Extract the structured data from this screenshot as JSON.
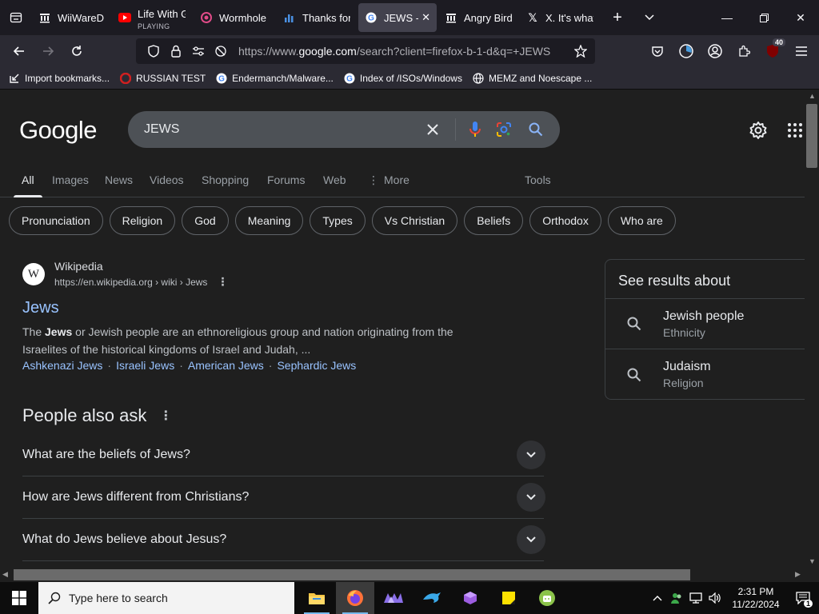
{
  "browser": {
    "tabs": [
      {
        "title": "WiiWareDL",
        "icon": "archive-icon"
      },
      {
        "title": "Life With G",
        "subtitle": "PLAYING",
        "icon": "youtube-icon"
      },
      {
        "title": "Wormhole",
        "icon": "wormhole-icon"
      },
      {
        "title": "Thanks for",
        "icon": "chart-icon"
      },
      {
        "title": "JEWS - G",
        "icon": "google-icon",
        "active": true
      },
      {
        "title": "Angry Bird",
        "icon": "archive-icon"
      },
      {
        "title": "X. It's what",
        "icon": "x-icon"
      }
    ],
    "url_prefix": "https://www.",
    "url_domain": "google.com",
    "url_rest": "/search?client=firefox-b-1-d&q=+JEWS",
    "extensions_badge": "40",
    "bookmarks": [
      {
        "label": "Import bookmarks...",
        "icon": "import-icon"
      },
      {
        "label": "RUSSIAN TEST",
        "icon": "red-circle-icon"
      },
      {
        "label": "Endermanch/Malware...",
        "icon": "google-icon"
      },
      {
        "label": "Index of /ISOs/Windows",
        "icon": "google-icon"
      },
      {
        "label": "MEMZ and Noescape ...",
        "icon": "globe-icon"
      }
    ]
  },
  "google": {
    "logo": "Google",
    "query": "JEWS",
    "tabs": [
      "All",
      "Images",
      "News",
      "Videos",
      "Shopping",
      "Forums",
      "Web",
      "More",
      "Tools"
    ],
    "chips": [
      "Pronunciation",
      "Religion",
      "God",
      "Meaning",
      "Types",
      "Vs Christian",
      "Beliefs",
      "Orthodox",
      "Who are"
    ],
    "result": {
      "source": "Wikipedia",
      "url": "https://en.wikipedia.org › wiki › Jews",
      "title": "Jews",
      "snippet_pre": "The ",
      "snippet_bold": "Jews",
      "snippet_post": " or Jewish people are an ethnoreligious group and nation originating from the Israelites of the historical kingdoms of Israel and Judah, ...",
      "sitelinks": [
        "Ashkenazi Jews",
        "Israeli Jews",
        "American Jews",
        "Sephardic Jews"
      ]
    },
    "paa": {
      "title": "People also ask",
      "questions": [
        "What are the beliefs of Jews?",
        "How are Jews different from Christians?",
        "What do Jews believe about Jesus?"
      ]
    },
    "see_results": {
      "title": "See results about",
      "items": [
        {
          "name": "Jewish people",
          "sub": "Ethnicity"
        },
        {
          "name": "Judaism",
          "sub": "Religion"
        }
      ]
    }
  },
  "taskbar": {
    "search_placeholder": "Type here to search",
    "time": "2:31 PM",
    "date": "11/22/2024",
    "notifications": "1"
  }
}
